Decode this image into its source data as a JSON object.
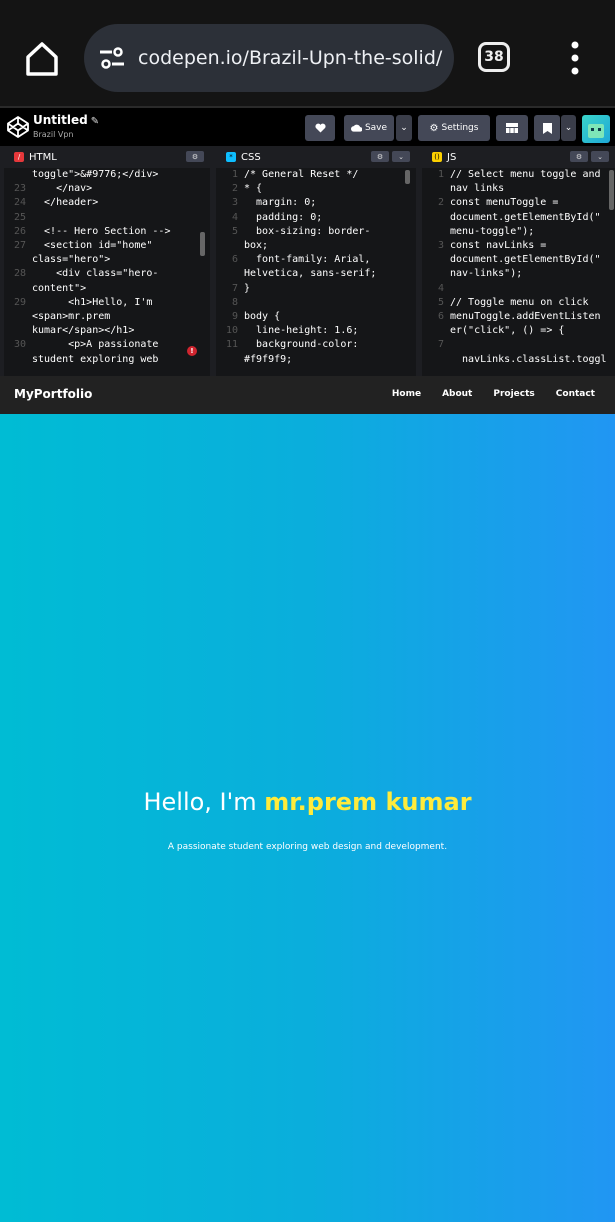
{
  "browser": {
    "url": "codepen.io/Brazil-Upn-the-solid/",
    "tab_count": "38"
  },
  "codepen": {
    "title": "Untitled",
    "subtitle": "Brazil Vpn",
    "save_label": "Save",
    "settings_label": "Settings"
  },
  "panes": [
    {
      "label": "HTML",
      "badge_color": "#e5383b",
      "lines": [
        {
          "n": "",
          "t": "toggle\">&#9776;</div>"
        },
        {
          "n": "23",
          "t": "    </nav>"
        },
        {
          "n": "24",
          "t": "  </header>"
        },
        {
          "n": "25",
          "t": ""
        },
        {
          "n": "26",
          "t": "  <!-- Hero Section -->"
        },
        {
          "n": "27",
          "t": "  <section id=\"home\""
        },
        {
          "n": "",
          "t": "class=\"hero\">"
        },
        {
          "n": "28",
          "t": "    <div class=\"hero-"
        },
        {
          "n": "",
          "t": "content\">"
        },
        {
          "n": "29",
          "t": "      <h1>Hello, I'm"
        },
        {
          "n": "",
          "t": "<span>mr.prem"
        },
        {
          "n": "",
          "t": "kumar</span></h1>"
        },
        {
          "n": "30",
          "t": "      <p>A passionate"
        },
        {
          "n": "",
          "t": "student exploring web"
        }
      ]
    },
    {
      "label": "CSS",
      "badge_color": "#0ebeff",
      "lines": [
        {
          "n": "1",
          "t": "/* General Reset */"
        },
        {
          "n": "2",
          "t": "* {"
        },
        {
          "n": "3",
          "t": "  margin: 0;"
        },
        {
          "n": "4",
          "t": "  padding: 0;"
        },
        {
          "n": "5",
          "t": "  box-sizing: border-"
        },
        {
          "n": "",
          "t": "box;"
        },
        {
          "n": "6",
          "t": "  font-family: Arial,"
        },
        {
          "n": "",
          "t": "Helvetica, sans-serif;"
        },
        {
          "n": "7",
          "t": "}"
        },
        {
          "n": "8",
          "t": ""
        },
        {
          "n": "9",
          "t": "body {"
        },
        {
          "n": "10",
          "t": "  line-height: 1.6;"
        },
        {
          "n": "11",
          "t": "  background-color:"
        },
        {
          "n": "",
          "t": "#f9f9f9;"
        }
      ]
    },
    {
      "label": "JS",
      "badge_color": "#fcd000",
      "lines": [
        {
          "n": "1",
          "t": "// Select menu toggle and"
        },
        {
          "n": "",
          "t": "nav links"
        },
        {
          "n": "2",
          "t": "const menuToggle ="
        },
        {
          "n": "",
          "t": "document.getElementById(\""
        },
        {
          "n": "",
          "t": "menu-toggle\");"
        },
        {
          "n": "3",
          "t": "const navLinks ="
        },
        {
          "n": "",
          "t": "document.getElementById(\""
        },
        {
          "n": "",
          "t": "nav-links\");"
        },
        {
          "n": "4",
          "t": ""
        },
        {
          "n": "5",
          "t": "// Toggle menu on click"
        },
        {
          "n": "6",
          "t": "menuToggle.addEventListen"
        },
        {
          "n": "",
          "t": "er(\"click\", () => {"
        },
        {
          "n": "7",
          "t": ""
        },
        {
          "n": "",
          "t": "  navLinks.classList.toggl"
        }
      ]
    }
  ],
  "site": {
    "logo": "MyPortfolio",
    "nav": [
      "Home",
      "About",
      "Projects",
      "Contact"
    ],
    "hero_greeting": "Hello, I'm ",
    "hero_name": "mr.prem kumar",
    "hero_sub": "A passionate student exploring web design and development."
  },
  "colors": {
    "hero_start": "#00bcd4",
    "hero_end": "#2196f3",
    "name_highlight": "#ffeb3b"
  },
  "icons": {
    "home": "home-icon",
    "tune": "tune-icon",
    "more": "more-vert-icon"
  }
}
